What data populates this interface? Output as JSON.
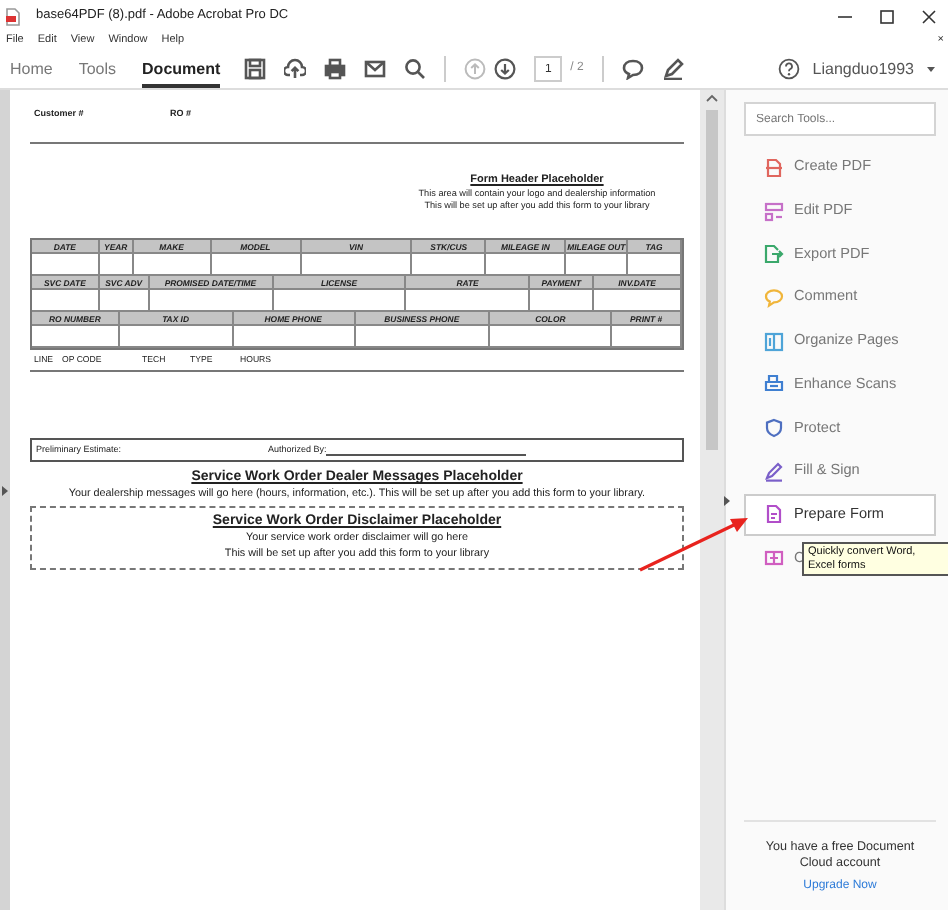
{
  "window": {
    "title": "base64PDF (8).pdf - Adobe Acrobat Pro DC"
  },
  "menu_bar": {
    "items": [
      "File",
      "Edit",
      "View",
      "Window",
      "Help"
    ],
    "close": "×"
  },
  "toolbar": {
    "tabs": [
      {
        "label": "Home",
        "selected": false
      },
      {
        "label": "Tools",
        "selected": false
      },
      {
        "label": "Document",
        "selected": true
      }
    ],
    "page_field": {
      "value": "1"
    },
    "page_total": "/ 2",
    "user": "Liangduo1993"
  },
  "document": {
    "customer_label": "Customer #",
    "ro_label": "RO #",
    "header": {
      "title": "Form Header Placeholder",
      "lines": [
        "This area will contain your logo and dealership information",
        "This will be set up after you add this form to your library"
      ]
    },
    "table": {
      "bands": [
        {
          "headers": [
            "DATE",
            "YEAR",
            "MAKE",
            "MODEL",
            "VIN",
            "STK/CUS",
            "MILEAGE IN",
            "MILEAGE OUT",
            "TAG"
          ]
        },
        {
          "headers": [
            "SVC DATE",
            "SVC ADV",
            "PROMISED DATE/TIME",
            "LICENSE",
            "RATE",
            "PAYMENT",
            "INV.DATE"
          ]
        },
        {
          "headers": [
            "RO NUMBER",
            "TAX ID",
            "HOME PHONE",
            "BUSINESS PHONE",
            "COLOR",
            "PRINT #"
          ]
        }
      ]
    },
    "labor_columns": [
      "LINE",
      "OP CODE",
      "TECH",
      "TYPE",
      "HOURS"
    ],
    "estimate": {
      "label": "Preliminary Estimate:",
      "authorized": "Authorized By:"
    },
    "messages": {
      "title": "Service Work Order Dealer Messages Placeholder",
      "text": "Your dealership messages will go here (hours, information, etc.).  This will be set up after you add this form to your library."
    },
    "disclaimer": {
      "title": "Service Work Order Disclaimer Placeholder",
      "lines": [
        "Your service work order disclaimer will go here",
        "This will be set up after you add this form to your library"
      ]
    }
  },
  "tools_panel": {
    "search": {
      "placeholder": "Search Tools..."
    },
    "tools": [
      {
        "label": "Create PDF",
        "color": "#e0665e",
        "selected": false
      },
      {
        "label": "Edit PDF",
        "color": "#c670c8",
        "selected": false
      },
      {
        "label": "Export PDF",
        "color": "#3aa86b",
        "selected": false
      },
      {
        "label": "Comment",
        "color": "#f0b53a",
        "selected": false
      },
      {
        "label": "Organize Pages",
        "color": "#4ea4d8",
        "selected": false
      },
      {
        "label": "Enhance Scans",
        "color": "#3f7fd1",
        "selected": false
      },
      {
        "label": "Protect",
        "color": "#4e6fc0",
        "selected": false
      },
      {
        "label": "Fill & Sign",
        "color": "#7a5fc9",
        "selected": false
      },
      {
        "label": "Prepare Form",
        "color": "#b14ec9",
        "selected": true
      },
      {
        "label": "C",
        "color": "#d05ec0",
        "selected": false
      }
    ],
    "tooltip": "Quickly convert Word, Excel forms",
    "promo": "You have a free Document Cloud account",
    "link": "Upgrade Now"
  }
}
